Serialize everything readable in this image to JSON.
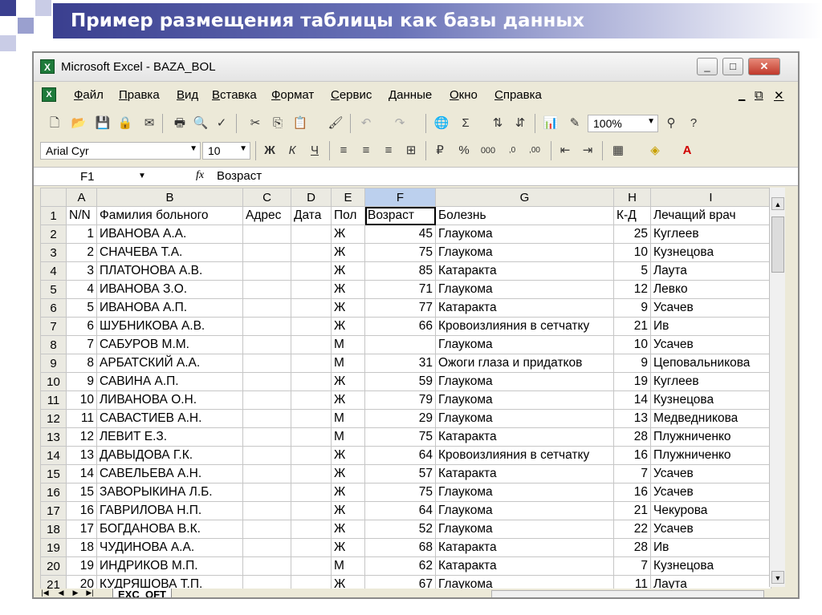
{
  "slide": {
    "title": "Пример размещения таблицы как базы данных"
  },
  "window": {
    "title": "Microsoft Excel - BAZA_BOL",
    "minimize": "_",
    "maximize": "□",
    "close": "✕"
  },
  "menu": [
    "Файл",
    "Правка",
    "Вид",
    "Вставка",
    "Формат",
    "Сервис",
    "Данные",
    "Окно",
    "Справка"
  ],
  "menu_controls": {
    "min": "_",
    "restore": "&#x1F5D7;",
    "close": "✕"
  },
  "toolbar": {
    "zoom": "100%",
    "font": "Arial Cyr",
    "size": "10"
  },
  "formula_bar": {
    "cell": "F1",
    "fx": "fx",
    "content": "Возраст"
  },
  "columns": [
    "A",
    "B",
    "C",
    "D",
    "E",
    "F",
    "G",
    "H",
    "I"
  ],
  "header_row": [
    "N/N",
    "Фамилия больного",
    "Адрес",
    "Дата",
    "Пол",
    "Возраст",
    "Болезнь",
    "К-Д",
    "Лечащий врач"
  ],
  "rows": [
    [
      "1",
      "ИВАНОВА А.А.",
      "",
      "",
      "Ж",
      "45",
      "Глаукома",
      "25",
      "Куглеев"
    ],
    [
      "2",
      "СНАЧЕВА Т.А.",
      "",
      "",
      "Ж",
      "75",
      "Глаукома",
      "10",
      "Кузнецова"
    ],
    [
      "3",
      "ПЛАТОНОВА А.В.",
      "",
      "",
      "Ж",
      "85",
      "Катаракта",
      "5",
      "Лаута"
    ],
    [
      "4",
      "ИВАНОВА З.О.",
      "",
      "",
      "Ж",
      "71",
      "Глаукома",
      "12",
      "Левко"
    ],
    [
      "5",
      "ИВАНОВА А.П.",
      "",
      "",
      "Ж",
      "77",
      "Катаракта",
      "9",
      "Усачев"
    ],
    [
      "6",
      "ШУБНИКОВА А.В.",
      "",
      "",
      "Ж",
      "66",
      "Кровоизлияния в сетчатку",
      "21",
      "Ив"
    ],
    [
      "7",
      "САБУРОВ М.М.",
      "",
      "",
      "М",
      "",
      "Глаукома",
      "10",
      "Усачев"
    ],
    [
      "8",
      "АРБАТСКИЙ А.А.",
      "",
      "",
      "М",
      "31",
      "Ожоги глаза и придатков",
      "9",
      "Цеповальникова"
    ],
    [
      "9",
      "САВИНА А.П.",
      "",
      "",
      "Ж",
      "59",
      "Глаукома",
      "19",
      "Куглеев"
    ],
    [
      "10",
      "ЛИВАНОВА О.Н.",
      "",
      "",
      "Ж",
      "79",
      "Глаукома",
      "14",
      "Кузнецова"
    ],
    [
      "11",
      "САВАСТИЕВ А.Н.",
      "",
      "",
      "М",
      "29",
      "Глаукома",
      "13",
      "Медведникова"
    ],
    [
      "12",
      "ЛЕВИТ Е.З.",
      "",
      "",
      "М",
      "75",
      "Катаракта",
      "28",
      "Плужниченко"
    ],
    [
      "13",
      "ДАВЫДОВА Г.К.",
      "",
      "",
      "Ж",
      "64",
      "Кровоизлияния в сетчатку",
      "16",
      "Плужниченко"
    ],
    [
      "14",
      "САВЕЛЬЕВА А.Н.",
      "",
      "",
      "Ж",
      "57",
      "Катаракта",
      "7",
      "Усачев"
    ],
    [
      "15",
      "ЗАВОРЫКИНА Л.Б.",
      "",
      "",
      "Ж",
      "75",
      "Глаукома",
      "16",
      "Усачев"
    ],
    [
      "16",
      "ГАВРИЛОВА Н.П.",
      "",
      "",
      "Ж",
      "64",
      "Глаукома",
      "21",
      "Чекурова"
    ],
    [
      "17",
      "БОГДАНОВА В.К.",
      "",
      "",
      "Ж",
      "52",
      "Глаукома",
      "22",
      "Усачев"
    ],
    [
      "18",
      "ЧУДИНОВА А.А.",
      "",
      "",
      "Ж",
      "68",
      "Катаракта",
      "28",
      "Ив"
    ],
    [
      "19",
      "ИНДРИКОВ М.П.",
      "",
      "",
      "М",
      "62",
      "Катаракта",
      "7",
      "Кузнецова"
    ],
    [
      "20",
      "КУДРЯШОВА Т.П.",
      "",
      "",
      "Ж",
      "67",
      "Глаукома",
      "11",
      "Лаута"
    ]
  ],
  "sheet_tab": "EXC_OFT"
}
